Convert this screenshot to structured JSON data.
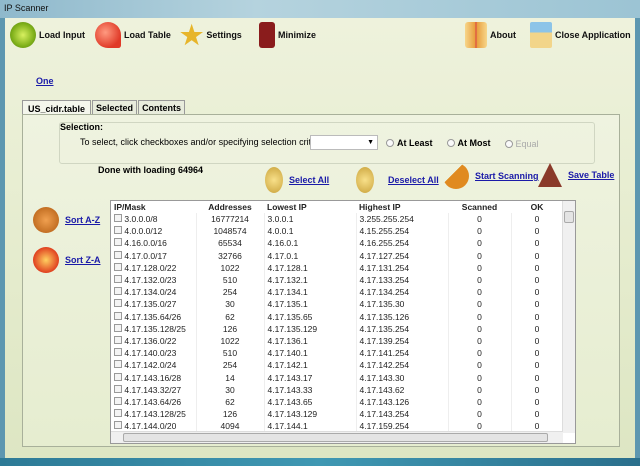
{
  "window": {
    "title": "IP Scanner"
  },
  "toolbar": {
    "load_input": "Load Input",
    "load_table": "Load Table",
    "settings": "Settings",
    "minimize": "Minimize",
    "about": "About",
    "close": "Close Application"
  },
  "link_one": "One",
  "tabs": [
    "US_cidr.table",
    "Selected",
    "Contents"
  ],
  "selection": {
    "label": "Selection:",
    "instruction": "To select, click checkboxes and/or specifying selection criteria:",
    "dropdown_value": "",
    "at_least": "At Least",
    "at_most": "At Most",
    "equal": "Equal"
  },
  "status": "Done with loading 64964",
  "actions": {
    "select_all": "Select All",
    "deselect_all": "Deselect All",
    "start_scanning": "Start Scanning",
    "save_table": "Save Table",
    "sort_az": "Sort A-Z",
    "sort_za": "Sort Z-A"
  },
  "table": {
    "columns": [
      "IP/Mask",
      "Addresses",
      "Lowest IP",
      "Highest IP",
      "Scanned",
      "OK"
    ],
    "rows": [
      [
        "3.0.0.0/8",
        "16777214",
        "3.0.0.1",
        "3.255.255.254",
        "0",
        "0"
      ],
      [
        "4.0.0.0/12",
        "1048574",
        "4.0.0.1",
        "4.15.255.254",
        "0",
        "0"
      ],
      [
        "4.16.0.0/16",
        "65534",
        "4.16.0.1",
        "4.16.255.254",
        "0",
        "0"
      ],
      [
        "4.17.0.0/17",
        "32766",
        "4.17.0.1",
        "4.17.127.254",
        "0",
        "0"
      ],
      [
        "4.17.128.0/22",
        "1022",
        "4.17.128.1",
        "4.17.131.254",
        "0",
        "0"
      ],
      [
        "4.17.132.0/23",
        "510",
        "4.17.132.1",
        "4.17.133.254",
        "0",
        "0"
      ],
      [
        "4.17.134.0/24",
        "254",
        "4.17.134.1",
        "4.17.134.254",
        "0",
        "0"
      ],
      [
        "4.17.135.0/27",
        "30",
        "4.17.135.1",
        "4.17.135.30",
        "0",
        "0"
      ],
      [
        "4.17.135.64/26",
        "62",
        "4.17.135.65",
        "4.17.135.126",
        "0",
        "0"
      ],
      [
        "4.17.135.128/25",
        "126",
        "4.17.135.129",
        "4.17.135.254",
        "0",
        "0"
      ],
      [
        "4.17.136.0/22",
        "1022",
        "4.17.136.1",
        "4.17.139.254",
        "0",
        "0"
      ],
      [
        "4.17.140.0/23",
        "510",
        "4.17.140.1",
        "4.17.141.254",
        "0",
        "0"
      ],
      [
        "4.17.142.0/24",
        "254",
        "4.17.142.1",
        "4.17.142.254",
        "0",
        "0"
      ],
      [
        "4.17.143.16/28",
        "14",
        "4.17.143.17",
        "4.17.143.30",
        "0",
        "0"
      ],
      [
        "4.17.143.32/27",
        "30",
        "4.17.143.33",
        "4.17.143.62",
        "0",
        "0"
      ],
      [
        "4.17.143.64/26",
        "62",
        "4.17.143.65",
        "4.17.143.126",
        "0",
        "0"
      ],
      [
        "4.17.143.128/25",
        "126",
        "4.17.143.129",
        "4.17.143.254",
        "0",
        "0"
      ],
      [
        "4.17.144.0/20",
        "4094",
        "4.17.144.1",
        "4.17.159.254",
        "0",
        "0"
      ]
    ]
  }
}
